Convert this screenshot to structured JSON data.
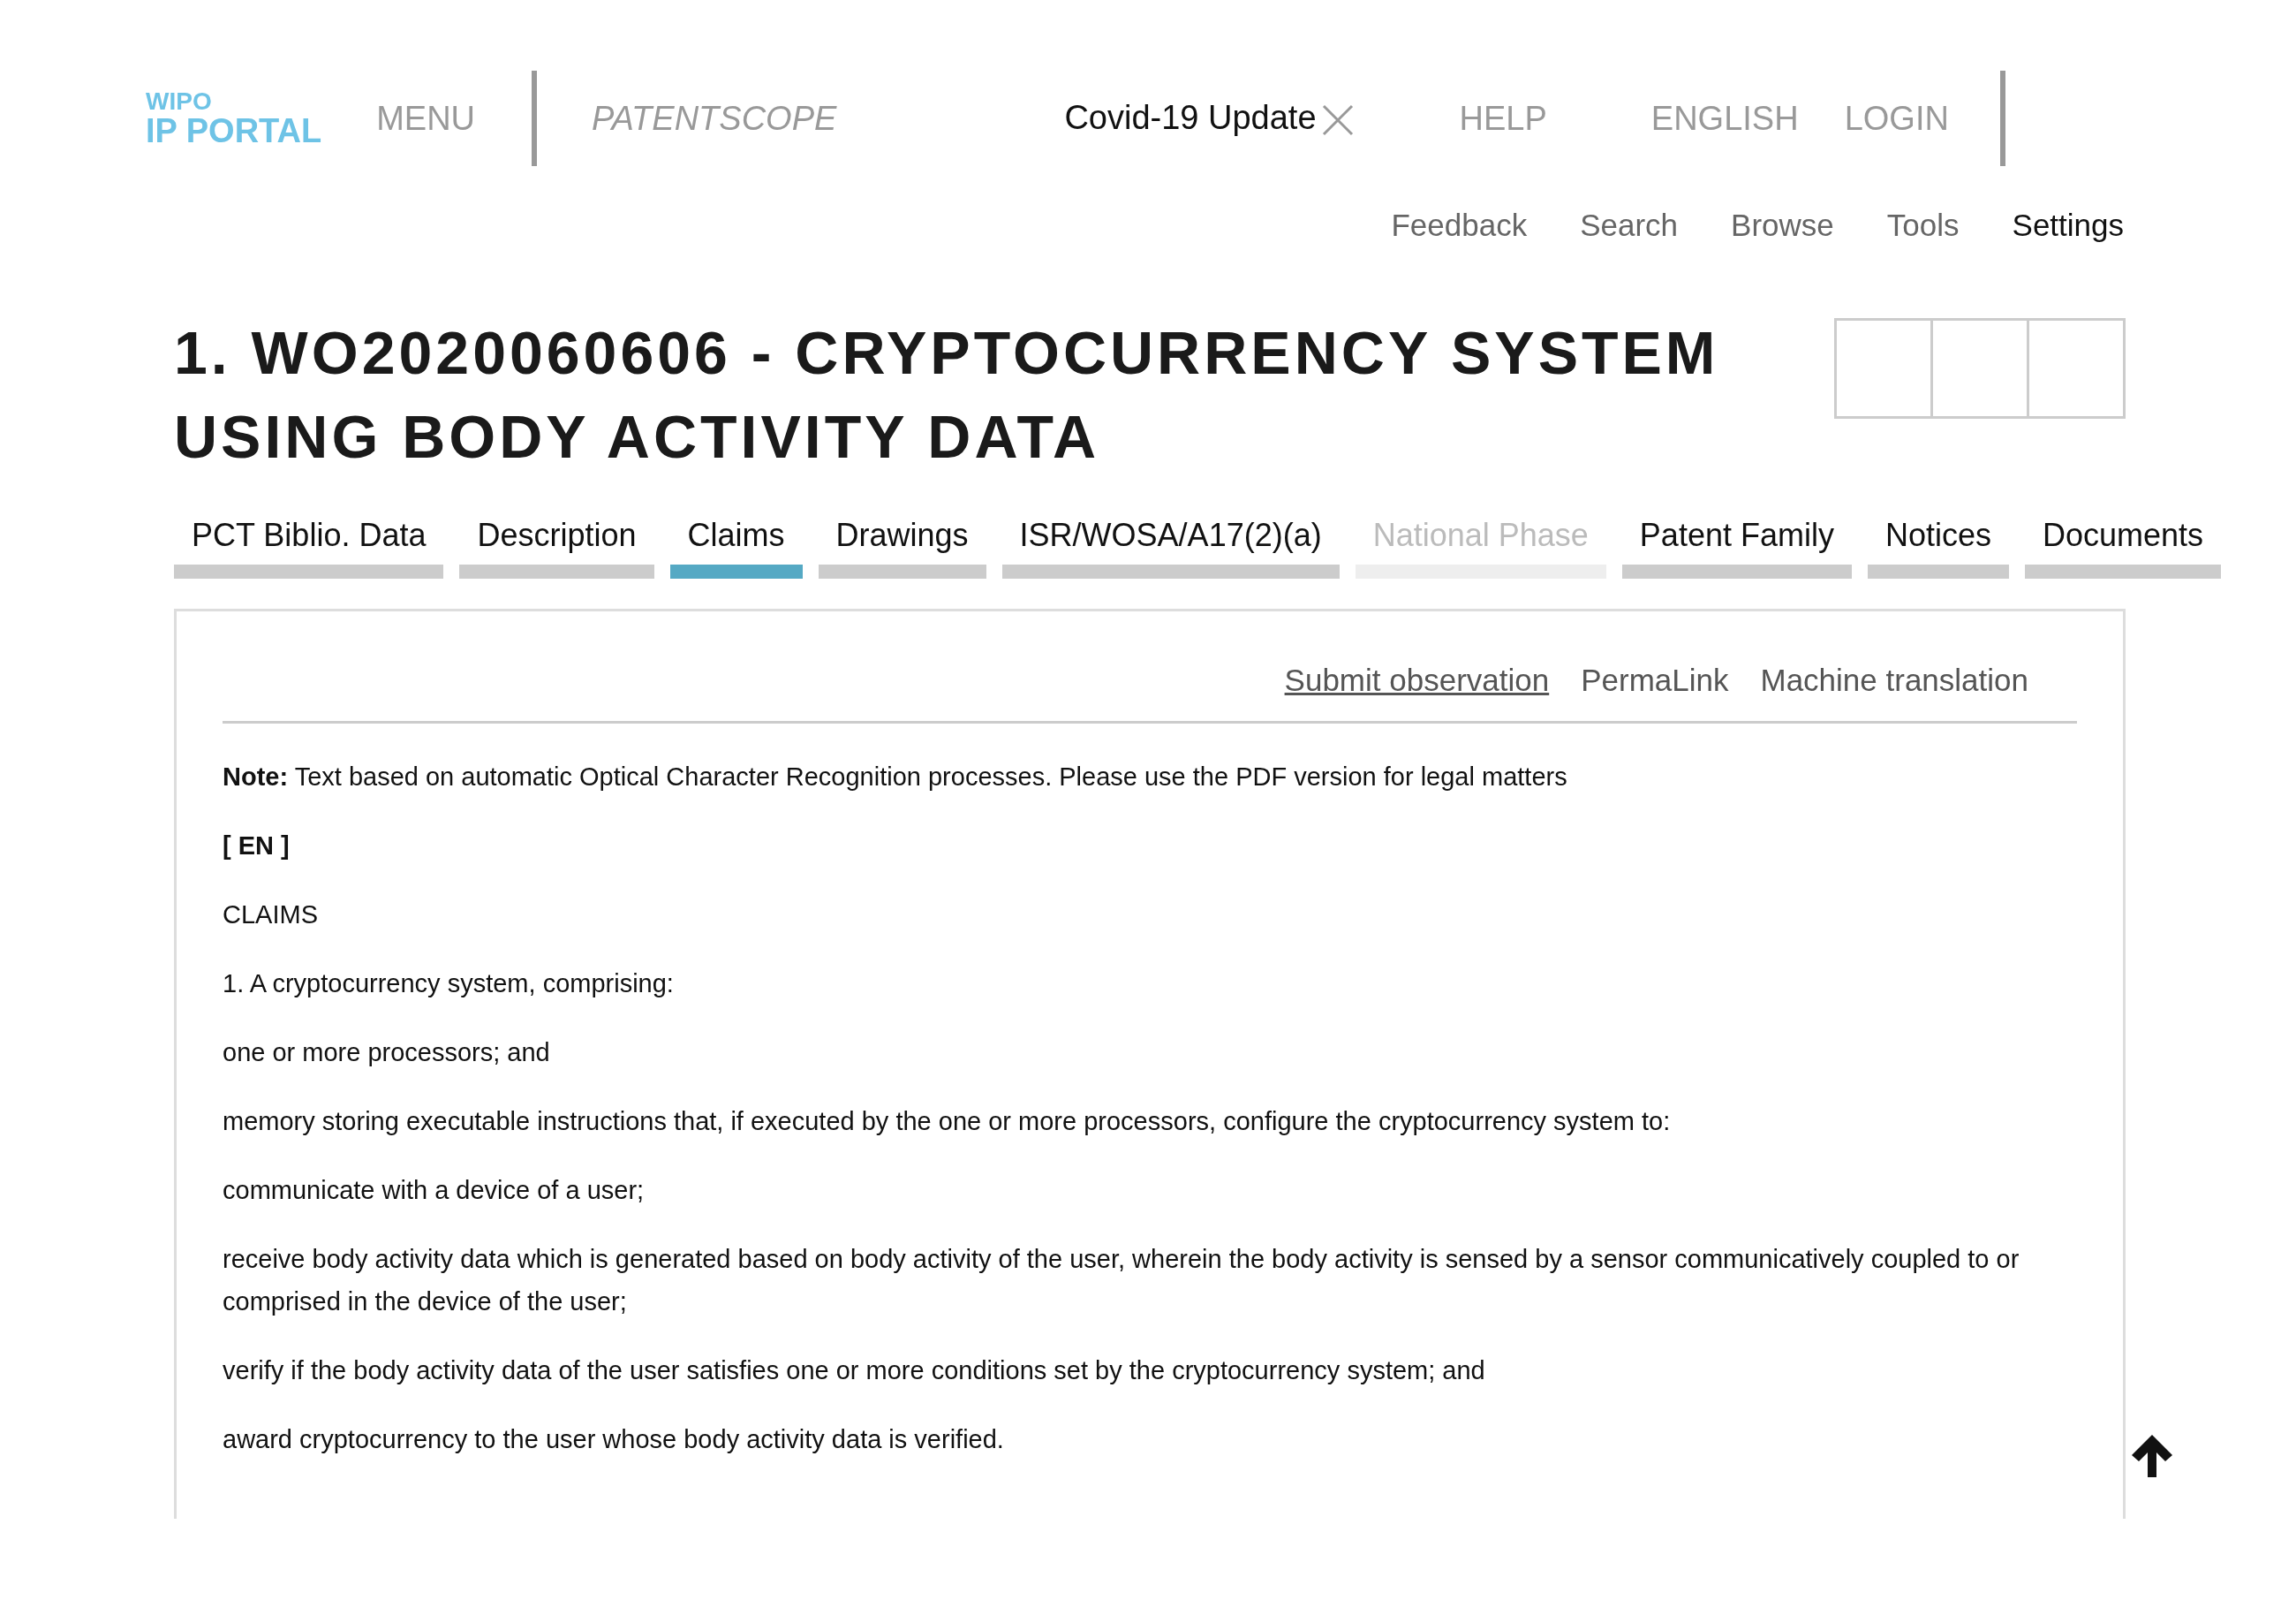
{
  "header": {
    "logo": [
      "WIPO",
      "IP PORTAL"
    ],
    "menu": "MENU",
    "site": "PATENTSCOPE",
    "notice": "Covid-19 Update",
    "help": "HELP",
    "language": "ENGLISH",
    "login": "LOGIN"
  },
  "subnav": [
    {
      "label": "Feedback",
      "selected": false
    },
    {
      "label": "Search",
      "selected": false
    },
    {
      "label": "Browse",
      "selected": false
    },
    {
      "label": "Tools",
      "selected": false
    },
    {
      "label": "Settings",
      "selected": true
    }
  ],
  "title": "1. WO2020060606 - CRYPTOCURRENCY SYSTEM USING BODY ACTIVITY DATA",
  "tabs": [
    {
      "label": "PCT Biblio. Data",
      "selected": false,
      "disabled": false
    },
    {
      "label": "Description",
      "selected": false,
      "disabled": false
    },
    {
      "label": "Claims",
      "selected": true,
      "disabled": false
    },
    {
      "label": "Drawings",
      "selected": false,
      "disabled": false
    },
    {
      "label": "ISR/WOSA/A17(2)(a)",
      "selected": false,
      "disabled": false
    },
    {
      "label": "National Phase",
      "selected": false,
      "disabled": true
    },
    {
      "label": "Patent Family",
      "selected": false,
      "disabled": false
    },
    {
      "label": "Notices",
      "selected": false,
      "disabled": false
    },
    {
      "label": "Documents",
      "selected": false,
      "disabled": false
    }
  ],
  "links": [
    {
      "label": "Submit observation",
      "underlined": true
    },
    {
      "label": "PermaLink",
      "underlined": false
    },
    {
      "label": "Machine translation",
      "underlined": false
    }
  ],
  "paragraphs": [
    {
      "kind": "note",
      "text": "**Note:** Text based on automatic Optical Character Recognition processes. Please use the PDF version for legal matters"
    },
    {
      "kind": "language",
      "text": "[ EN ]"
    },
    {
      "kind": "text",
      "text": "CLAIMS"
    },
    {
      "kind": "text",
      "text": "1. A cryptocurrency system, comprising:"
    },
    {
      "kind": "text",
      "text": "one or more processors; and"
    },
    {
      "kind": "text",
      "text": "memory storing executable instructions that, if executed by the one or more processors, configure the cryptocurrency system to:"
    },
    {
      "kind": "text",
      "text": "communicate with a device of a user;"
    },
    {
      "kind": "text",
      "text": "receive body activity data which is generated based on body activity of the user, wherein the body activity is sensed by a sensor communicatively coupled to or comprised in the device of the user;"
    },
    {
      "kind": "text",
      "text": "verify if the body activity data of the user satisfies one or more conditions set by the cryptocurrency system; and"
    },
    {
      "kind": "text",
      "text": "award cryptocurrency to the user whose body activity data is verified."
    }
  ]
}
